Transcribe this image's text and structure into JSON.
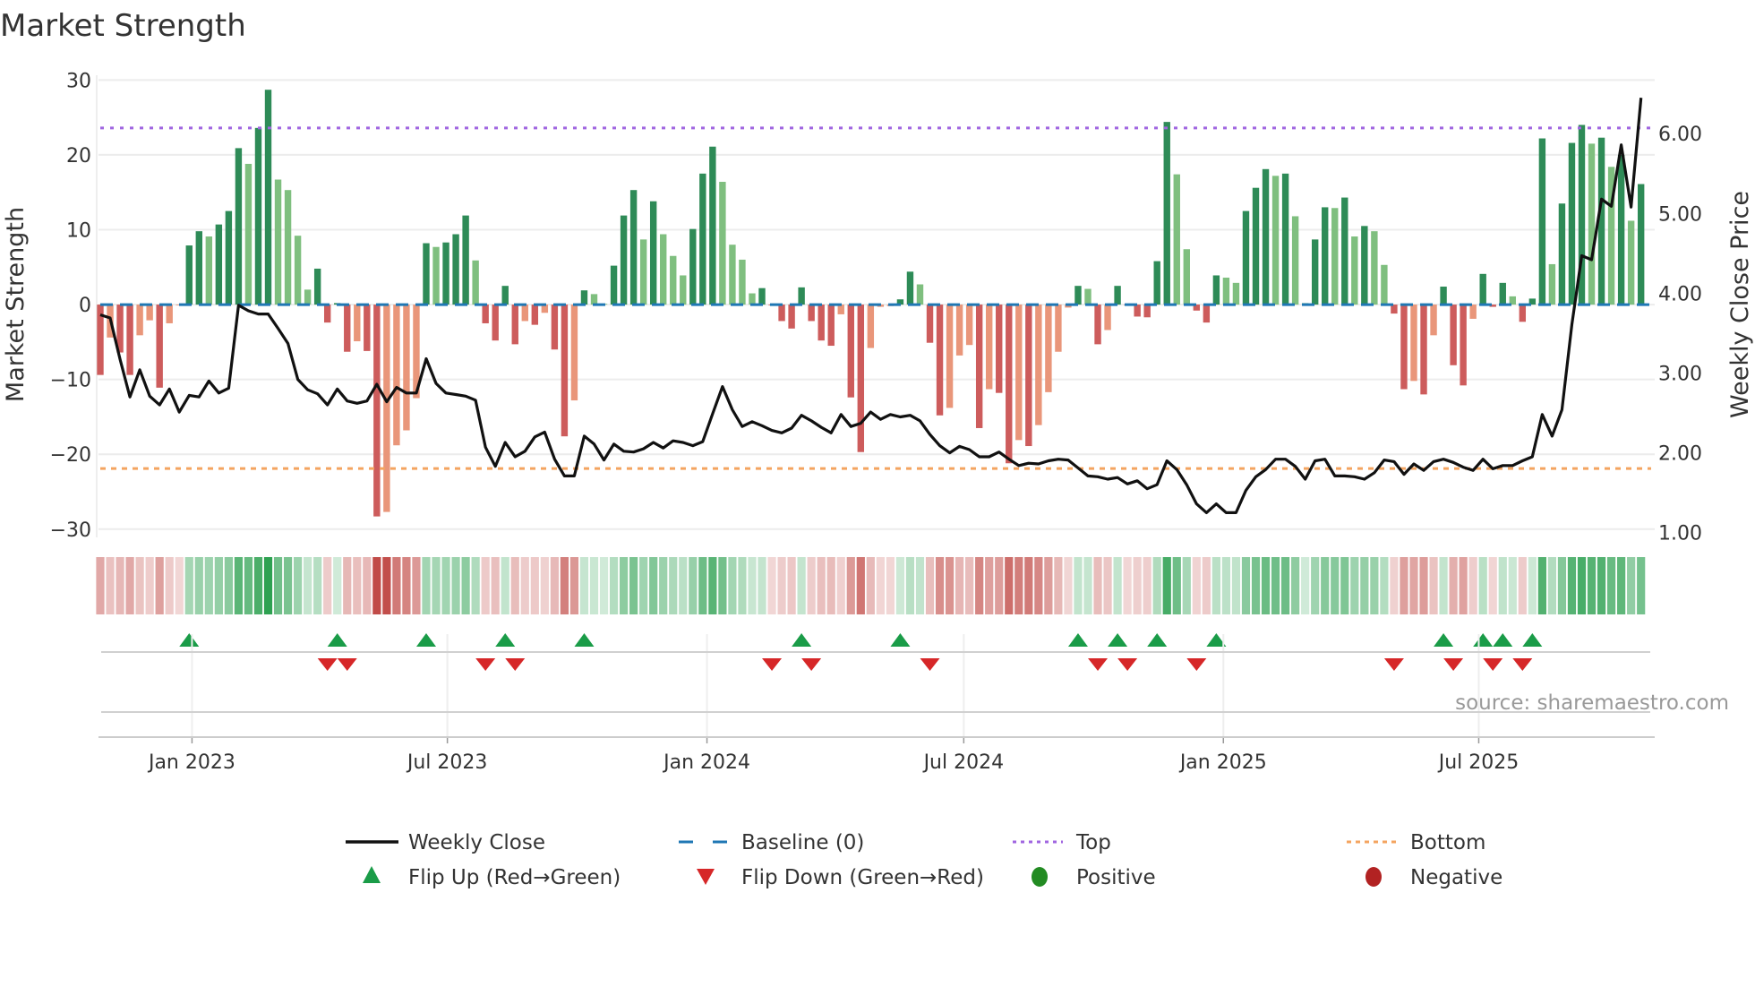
{
  "chart_data": {
    "type": "bar",
    "title": "Market Strength",
    "ylabel_left": "Market Strength",
    "ylabel_right": "Weekly Close Price",
    "ylim_left": [
      -31.1,
      30.4
    ],
    "ylim_right": [
      0.94,
      6.71
    ],
    "left_ticks": [
      "30",
      "20",
      "10",
      "0",
      "−10",
      "−20",
      "−30"
    ],
    "left_tick_values": [
      30,
      20,
      10,
      0,
      -10,
      -20,
      -30
    ],
    "right_ticks": [
      "6.00",
      "5.00",
      "4.00",
      "3.00",
      "2.00",
      "1.00"
    ],
    "right_tick_values": [
      6,
      5,
      4,
      3,
      2,
      1
    ],
    "x_ticks": [
      {
        "label": "Jan 2023",
        "date": "2023-01-01"
      },
      {
        "label": "Jul 2023",
        "date": "2023-07-01"
      },
      {
        "label": "Jan 2024",
        "date": "2024-01-01"
      },
      {
        "label": "Jul 2024",
        "date": "2024-07-01"
      },
      {
        "label": "Jan 2025",
        "date": "2025-01-01"
      },
      {
        "label": "Jul 2025",
        "date": "2025-07-01"
      }
    ],
    "grid": true,
    "top_level": 23.6,
    "bottom_level": -21.9,
    "baseline": 0,
    "dates": [
      "2022-10-28",
      "2022-11-04",
      "2022-11-11",
      "2022-11-18",
      "2022-11-25",
      "2022-12-02",
      "2022-12-09",
      "2022-12-16",
      "2022-12-23",
      "2022-12-30",
      "2023-01-06",
      "2023-01-13",
      "2023-01-20",
      "2023-01-27",
      "2023-02-03",
      "2023-02-10",
      "2023-02-17",
      "2023-02-24",
      "2023-03-03",
      "2023-03-10",
      "2023-03-17",
      "2023-03-24",
      "2023-03-31",
      "2023-04-07",
      "2023-04-14",
      "2023-04-21",
      "2023-04-28",
      "2023-05-05",
      "2023-05-12",
      "2023-05-19",
      "2023-05-26",
      "2023-06-02",
      "2023-06-09",
      "2023-06-16",
      "2023-06-23",
      "2023-06-30",
      "2023-07-07",
      "2023-07-14",
      "2023-07-21",
      "2023-07-28",
      "2023-08-04",
      "2023-08-11",
      "2023-08-18",
      "2023-08-25",
      "2023-09-01",
      "2023-09-08",
      "2023-09-15",
      "2023-09-22",
      "2023-09-29",
      "2023-10-06",
      "2023-10-13",
      "2023-10-20",
      "2023-10-27",
      "2023-11-03",
      "2023-11-10",
      "2023-11-17",
      "2023-11-24",
      "2023-12-01",
      "2023-12-08",
      "2023-12-15",
      "2023-12-22",
      "2023-12-29",
      "2024-01-05",
      "2024-01-12",
      "2024-01-19",
      "2024-01-26",
      "2024-02-02",
      "2024-02-09",
      "2024-02-16",
      "2024-02-23",
      "2024-03-01",
      "2024-03-08",
      "2024-03-15",
      "2024-03-22",
      "2024-03-29",
      "2024-04-05",
      "2024-04-12",
      "2024-04-19",
      "2024-04-26",
      "2024-05-03",
      "2024-05-10",
      "2024-05-17",
      "2024-05-24",
      "2024-05-31",
      "2024-06-07",
      "2024-06-14",
      "2024-06-21",
      "2024-06-28",
      "2024-07-05",
      "2024-07-12",
      "2024-07-19",
      "2024-07-26",
      "2024-08-02",
      "2024-08-09",
      "2024-08-16",
      "2024-08-23",
      "2024-08-30",
      "2024-09-06",
      "2024-09-13",
      "2024-09-20",
      "2024-09-27",
      "2024-10-04",
      "2024-10-11",
      "2024-10-18",
      "2024-10-25",
      "2024-11-01",
      "2024-11-08",
      "2024-11-15",
      "2024-11-22",
      "2024-11-29",
      "2024-12-06",
      "2024-12-13",
      "2024-12-20",
      "2024-12-27",
      "2025-01-03",
      "2025-01-10",
      "2025-01-17",
      "2025-01-24",
      "2025-01-31",
      "2025-02-07",
      "2025-02-14",
      "2025-02-21",
      "2025-02-28",
      "2025-03-07",
      "2025-03-14",
      "2025-03-21",
      "2025-03-28",
      "2025-04-04",
      "2025-04-11",
      "2025-04-18",
      "2025-04-25",
      "2025-05-02",
      "2025-05-09",
      "2025-05-16",
      "2025-05-23",
      "2025-05-30",
      "2025-06-06",
      "2025-06-13",
      "2025-06-20",
      "2025-06-27",
      "2025-07-04",
      "2025-07-11",
      "2025-07-18",
      "2025-07-25",
      "2025-08-01",
      "2025-08-08",
      "2025-08-15",
      "2025-08-22",
      "2025-08-29",
      "2025-09-05",
      "2025-09-12",
      "2025-09-19",
      "2025-09-26",
      "2025-10-03",
      "2025-10-10",
      "2025-10-17",
      "2025-10-24"
    ],
    "series": [
      {
        "name": "Market Strength",
        "axis": "left",
        "type": "bar",
        "values": [
          -9.4,
          -4.4,
          -6.4,
          -9.4,
          -4.1,
          -2.1,
          -11.1,
          -2.5,
          -0.1,
          7.9,
          9.8,
          9.1,
          10.7,
          12.5,
          20.9,
          18.8,
          23.6,
          28.7,
          16.7,
          15.3,
          9.2,
          2.0,
          4.8,
          -2.4,
          0.2,
          -6.3,
          -4.9,
          -6.2,
          -28.3,
          -27.7,
          -18.8,
          -16.8,
          -12.5,
          8.2,
          7.7,
          8.3,
          9.4,
          11.9,
          5.9,
          -2.5,
          -4.8,
          2.5,
          -5.3,
          -2.2,
          -2.7,
          -1.1,
          -6.0,
          -17.6,
          -12.8,
          1.9,
          1.4,
          0.1,
          5.2,
          11.9,
          15.3,
          8.7,
          13.8,
          9.4,
          6.5,
          3.9,
          10.1,
          17.5,
          21.1,
          16.4,
          8.0,
          6.0,
          1.5,
          2.2,
          -0.1,
          -2.2,
          -3.2,
          2.3,
          -2.2,
          -4.8,
          -5.5,
          -1.3,
          -12.4,
          -19.7,
          -5.8,
          -0.3,
          -0.2,
          0.7,
          4.4,
          2.7,
          -5.1,
          -14.8,
          -13.8,
          -6.8,
          -5.4,
          -16.5,
          -11.3,
          -11.8,
          -21.2,
          -18.1,
          -18.9,
          -16.1,
          -11.7,
          -6.3,
          -0.4,
          2.5,
          2.1,
          -5.3,
          -3.4,
          2.5,
          -0.1,
          -1.6,
          -1.7,
          5.8,
          24.4,
          17.4,
          7.4,
          -0.8,
          -2.4,
          3.9,
          3.6,
          2.9,
          12.5,
          15.6,
          18.1,
          17.2,
          17.5,
          11.8,
          0.2,
          8.7,
          13.0,
          12.9,
          14.3,
          9.1,
          10.5,
          9.8,
          5.3,
          -1.2,
          -11.3,
          -10.2,
          -12.0,
          -4.1,
          2.4,
          -8.1,
          -10.8,
          -1.9,
          4.1,
          -0.3,
          2.9,
          1.1,
          -2.3,
          0.8,
          22.2,
          5.4,
          13.5,
          21.6,
          24.0,
          21.5,
          22.3,
          18.4,
          20.0,
          11.2,
          16.1
        ]
      },
      {
        "name": "Weekly Close",
        "axis": "right",
        "type": "line",
        "values": [
          3.73,
          3.69,
          3.17,
          2.7,
          3.04,
          2.71,
          2.6,
          2.8,
          2.51,
          2.72,
          2.7,
          2.9,
          2.75,
          2.81,
          3.85,
          3.78,
          3.74,
          3.74,
          3.56,
          3.37,
          2.92,
          2.79,
          2.74,
          2.6,
          2.8,
          2.65,
          2.62,
          2.65,
          2.86,
          2.64,
          2.82,
          2.75,
          2.75,
          3.18,
          2.87,
          2.75,
          2.73,
          2.71,
          2.66,
          2.07,
          1.83,
          2.13,
          1.95,
          2.02,
          2.2,
          2.26,
          1.92,
          1.71,
          1.71,
          2.21,
          2.11,
          1.91,
          2.11,
          2.02,
          2.01,
          2.05,
          2.13,
          2.06,
          2.15,
          2.13,
          2.09,
          2.14,
          2.49,
          2.83,
          2.54,
          2.33,
          2.39,
          2.34,
          2.28,
          2.25,
          2.31,
          2.47,
          2.4,
          2.32,
          2.25,
          2.48,
          2.33,
          2.37,
          2.51,
          2.42,
          2.48,
          2.45,
          2.47,
          2.4,
          2.23,
          2.09,
          2.0,
          2.08,
          2.04,
          1.95,
          1.95,
          2.01,
          1.92,
          1.84,
          1.87,
          1.86,
          1.9,
          1.92,
          1.91,
          1.81,
          1.71,
          1.7,
          1.67,
          1.69,
          1.61,
          1.65,
          1.55,
          1.6,
          1.9,
          1.79,
          1.6,
          1.36,
          1.25,
          1.36,
          1.25,
          1.25,
          1.53,
          1.7,
          1.79,
          1.92,
          1.92,
          1.83,
          1.67,
          1.9,
          1.92,
          1.71,
          1.71,
          1.7,
          1.67,
          1.75,
          1.91,
          1.89,
          1.73,
          1.86,
          1.78,
          1.89,
          1.92,
          1.88,
          1.82,
          1.78,
          1.92,
          1.8,
          1.84,
          1.84,
          1.9,
          1.95,
          2.48,
          2.21,
          2.54,
          3.61,
          4.47,
          4.42,
          5.18,
          5.09,
          5.86,
          5.08,
          6.45
        ]
      }
    ],
    "flips": {
      "up": [
        "2022-12-30",
        "2023-04-14",
        "2023-06-16",
        "2023-08-11",
        "2023-10-06",
        "2024-03-08",
        "2024-05-17",
        "2024-09-20",
        "2024-10-18",
        "2024-11-15",
        "2024-12-27",
        "2025-06-06",
        "2025-07-04",
        "2025-07-18",
        "2025-08-08"
      ],
      "down": [
        "2023-04-07",
        "2023-04-21",
        "2023-07-28",
        "2023-08-18",
        "2024-02-16",
        "2024-03-15",
        "2024-06-07",
        "2024-10-04",
        "2024-10-25",
        "2024-12-13",
        "2025-05-02",
        "2025-06-13",
        "2025-07-11",
        "2025-08-01"
      ]
    },
    "colors": {
      "positive_strong": "#2e8b57",
      "positive_weak": "#7fbf7f",
      "negative_strong": "#cd5c5c",
      "negative_weak": "#e9967a",
      "heat_positive": "#2ca050",
      "heat_negative": "#c04844",
      "price_line": "#111111",
      "baseline": "#1f77b4",
      "top": "#a066e0",
      "bottom": "#f4a460",
      "flip_up": "#1a9c48",
      "flip_down": "#d62728",
      "legend_positive": "#228b22",
      "legend_negative": "#b22222"
    },
    "legend": {
      "weekly_close": "Weekly Close",
      "baseline": "Baseline (0)",
      "top": "Top",
      "bottom": "Bottom",
      "flip_up": "Flip Up (Red→Green)",
      "flip_down": "Flip Down (Green→Red)",
      "positive": "Positive",
      "negative": "Negative"
    },
    "source": "source: sharemaestro.com"
  }
}
